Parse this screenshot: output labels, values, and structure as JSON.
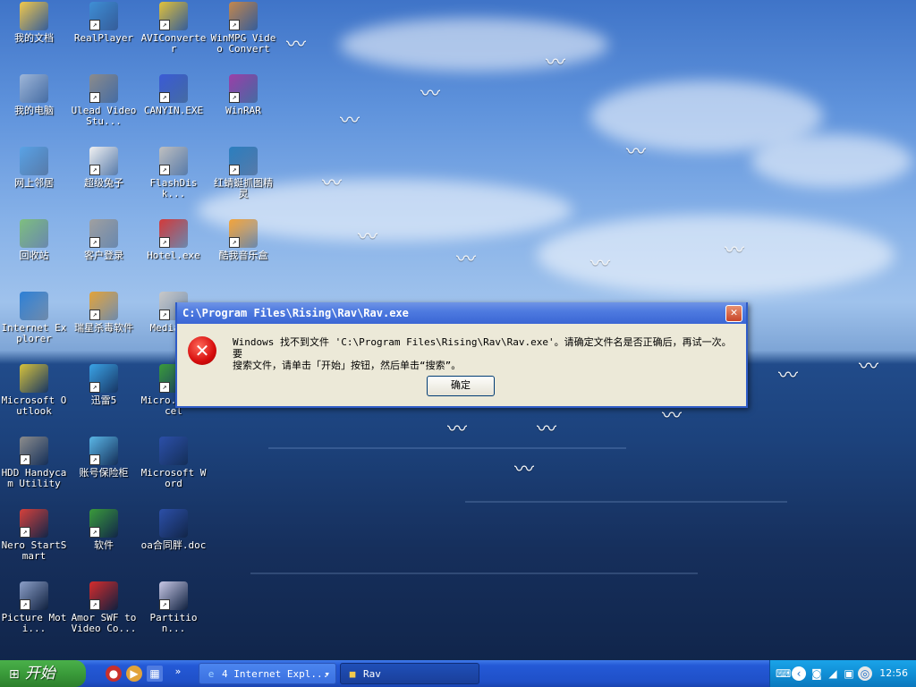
{
  "desktop_icons": [
    {
      "label": "我的文档",
      "icon": "folder-icon",
      "color": "#f2c94c"
    },
    {
      "label": "RealPlayer",
      "icon": "realplayer-icon",
      "color": "#3f8fd6"
    },
    {
      "label": "AVIConverter",
      "icon": "note-icon",
      "color": "#e2c23b"
    },
    {
      "label": "WinMPG Video Convert",
      "icon": "film-icon",
      "color": "#c4884e"
    },
    {
      "label": "我的电脑",
      "icon": "computer-icon",
      "color": "#9fb7d9"
    },
    {
      "label": "Ulead VideoStu...",
      "icon": "ulead-icon",
      "color": "#8c8c8c"
    },
    {
      "label": "CANYIN.EXE",
      "icon": "exe-icon",
      "color": "#3b5bd6"
    },
    {
      "label": "WinRAR",
      "icon": "winrar-icon",
      "color": "#9c3fa8"
    },
    {
      "label": "网上邻居",
      "icon": "network-icon",
      "color": "#5aa3e6"
    },
    {
      "label": "超级兔子",
      "icon": "rabbit-icon",
      "color": "#f2f2f2"
    },
    {
      "label": "FlashDisk...",
      "icon": "flashdisk-icon",
      "color": "#c0c0c0"
    },
    {
      "label": "红蜻蜓抓图精灵",
      "icon": "camera-icon",
      "color": "#2c7fbf"
    },
    {
      "label": "回收站",
      "icon": "recycle-bin-icon",
      "color": "#7fbf7f"
    },
    {
      "label": "客户登录",
      "icon": "login-icon",
      "color": "#a0a0a0"
    },
    {
      "label": "Hotel.exe",
      "icon": "hotel-icon",
      "color": "#d43a3a"
    },
    {
      "label": "酷我音乐盒",
      "icon": "music-box-icon",
      "color": "#f2a33a"
    },
    {
      "label": "Internet Explorer",
      "icon": "ie-icon",
      "color": "#2c7fd6"
    },
    {
      "label": "瑞星杀毒软件",
      "icon": "rising-icon",
      "color": "#e2a33a"
    },
    {
      "label": "Media...",
      "icon": "media-icon",
      "color": "#c8c8c8"
    },
    {
      "label": "Microsoft Outlook",
      "icon": "outlook-icon",
      "color": "#d6c23a"
    },
    {
      "label": "迅雷5",
      "icon": "thunder-icon",
      "color": "#3aa3e6"
    },
    {
      "label": "Micro... Excel",
      "icon": "excel-icon",
      "color": "#3a9b3a"
    },
    {
      "label": "HDD Handycam Utility",
      "icon": "handycam-icon",
      "color": "#8c8c8c"
    },
    {
      "label": "账号保险柜",
      "icon": "safe-icon",
      "color": "#5ab6e6"
    },
    {
      "label": "Microsoft Word",
      "icon": "word-icon",
      "color": "#2c4fa8"
    },
    {
      "label": "Nero StartSmart",
      "icon": "nero-icon",
      "color": "#d6403a"
    },
    {
      "label": "软件",
      "icon": "tree-icon",
      "color": "#3a9b3a"
    },
    {
      "label": "oa合同胖.doc",
      "icon": "doc-icon",
      "color": "#2c4fa8"
    },
    {
      "label": "Picture Moti...",
      "icon": "picture-icon",
      "color": "#8c9fc8"
    },
    {
      "label": "Amor SWF to Video Co...",
      "icon": "flash-icon",
      "color": "#d62c2c"
    },
    {
      "label": "Partition...",
      "icon": "partition-icon",
      "color": "#c8c8e6"
    }
  ],
  "dialog": {
    "title": "C:\\Program Files\\Rising\\Rav\\Rav.exe",
    "message_line1": "Windows 找不到文件 'C:\\Program Files\\Rising\\Rav\\Rav.exe'。请确定文件名是否正确后，再试一次。要",
    "message_line2": "搜索文件，请单击「开始」按钮，然后单击“搜索”。",
    "ok_label": "确定",
    "close_glyph": "✕",
    "error_glyph": "✕"
  },
  "taskbar": {
    "start_label": "开始",
    "start_glyph": "⊞",
    "chevron": "»",
    "tasks": [
      {
        "label": "4 Internet Expl...",
        "icon": "ie-icon",
        "dropdown": "▾"
      },
      {
        "label": "Rav",
        "icon": "folder-icon"
      }
    ],
    "tray_prev_glyph": "‹",
    "clock": "12:56"
  }
}
